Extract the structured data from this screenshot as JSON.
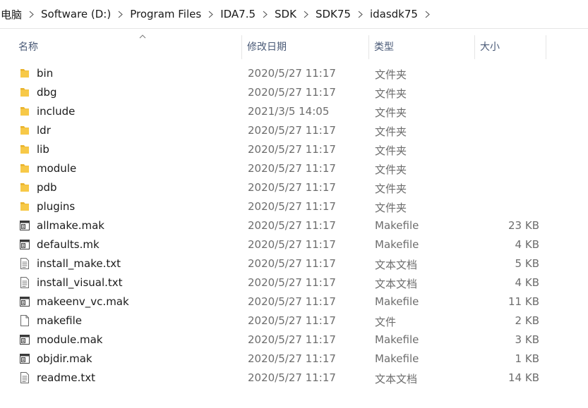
{
  "breadcrumb": {
    "items": [
      "电脑",
      "Software (D:)",
      "Program Files",
      "IDA7.5",
      "SDK",
      "SDK75",
      "idasdk75"
    ]
  },
  "columns": {
    "name": "名称",
    "date": "修改日期",
    "type": "类型",
    "size": "大小"
  },
  "colors": {
    "folder": "#f7c948",
    "header_text": "#4a5a77",
    "meta_text": "#6d6d6d"
  },
  "files": [
    {
      "name": "bin",
      "date": "2020/5/27 11:17",
      "type": "文件夹",
      "size": "",
      "icon": "folder-icon"
    },
    {
      "name": "dbg",
      "date": "2020/5/27 11:17",
      "type": "文件夹",
      "size": "",
      "icon": "folder-icon"
    },
    {
      "name": "include",
      "date": "2021/3/5 14:05",
      "type": "文件夹",
      "size": "",
      "icon": "folder-icon"
    },
    {
      "name": "ldr",
      "date": "2020/5/27 11:17",
      "type": "文件夹",
      "size": "",
      "icon": "folder-icon"
    },
    {
      "name": "lib",
      "date": "2020/5/27 11:17",
      "type": "文件夹",
      "size": "",
      "icon": "folder-icon"
    },
    {
      "name": "module",
      "date": "2020/5/27 11:17",
      "type": "文件夹",
      "size": "",
      "icon": "folder-icon"
    },
    {
      "name": "pdb",
      "date": "2020/5/27 11:17",
      "type": "文件夹",
      "size": "",
      "icon": "folder-icon"
    },
    {
      "name": "plugins",
      "date": "2020/5/27 11:17",
      "type": "文件夹",
      "size": "",
      "icon": "folder-icon"
    },
    {
      "name": "allmake.mak",
      "date": "2020/5/27 11:17",
      "type": "Makefile",
      "size": "23 KB",
      "icon": "makefile-icon"
    },
    {
      "name": "defaults.mk",
      "date": "2020/5/27 11:17",
      "type": "Makefile",
      "size": "4 KB",
      "icon": "makefile-icon"
    },
    {
      "name": "install_make.txt",
      "date": "2020/5/27 11:17",
      "type": "文本文档",
      "size": "5 KB",
      "icon": "text-file-icon"
    },
    {
      "name": "install_visual.txt",
      "date": "2020/5/27 11:17",
      "type": "文本文档",
      "size": "4 KB",
      "icon": "text-file-icon"
    },
    {
      "name": "makeenv_vc.mak",
      "date": "2020/5/27 11:17",
      "type": "Makefile",
      "size": "11 KB",
      "icon": "makefile-icon"
    },
    {
      "name": "makefile",
      "date": "2020/5/27 11:17",
      "type": "文件",
      "size": "2 KB",
      "icon": "blank-file-icon"
    },
    {
      "name": "module.mak",
      "date": "2020/5/27 11:17",
      "type": "Makefile",
      "size": "3 KB",
      "icon": "makefile-icon"
    },
    {
      "name": "objdir.mak",
      "date": "2020/5/27 11:17",
      "type": "Makefile",
      "size": "1 KB",
      "icon": "makefile-icon"
    },
    {
      "name": "readme.txt",
      "date": "2020/5/27 11:17",
      "type": "文本文档",
      "size": "14 KB",
      "icon": "text-file-icon"
    }
  ]
}
